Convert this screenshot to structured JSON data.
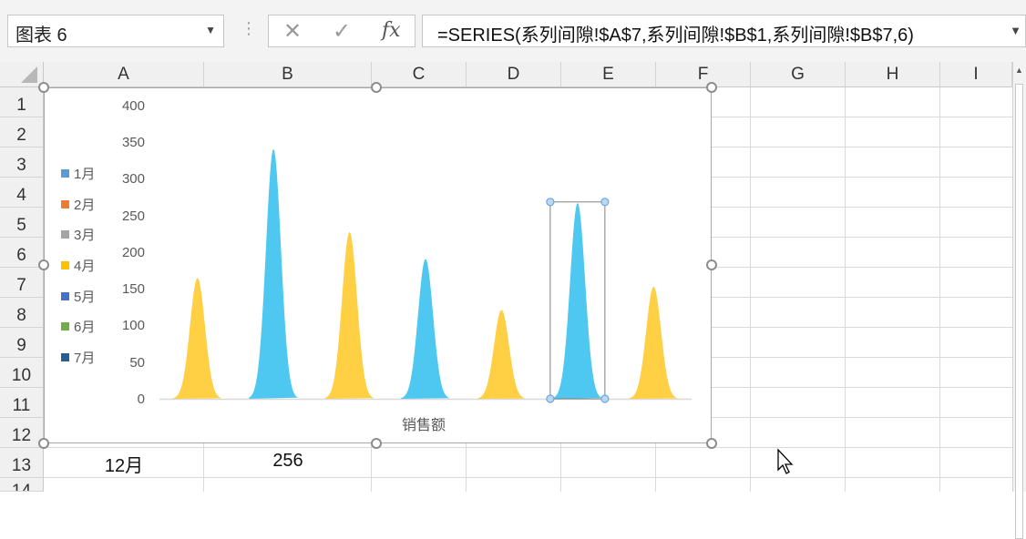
{
  "namebox": {
    "value": "图表 6"
  },
  "formula_bar": {
    "formula": "=SERIES(系列间隙!$A$7,系列间隙!$B$1,系列间隙!$B$7,6)"
  },
  "columns": [
    "A",
    "B",
    "C",
    "D",
    "E",
    "F",
    "G",
    "H",
    "I"
  ],
  "rows": [
    "1",
    "2",
    "3",
    "4",
    "5",
    "6",
    "7",
    "8",
    "9",
    "10",
    "11",
    "12",
    "13",
    "14"
  ],
  "cells": {
    "A13": "12月",
    "B13": "256"
  },
  "icons": {
    "cancel": "close-icon",
    "confirm": "check-icon",
    "function": "fx-icon"
  },
  "colors": {
    "yellow": "#FFCF44",
    "blue": "#4EC8F0",
    "selection": "#6AA6E0"
  },
  "chart_data": {
    "type": "area",
    "title": "",
    "xlabel": "销售额",
    "ylabel": "",
    "ylim": [
      0,
      400
    ],
    "yticks": [
      "0",
      "50",
      "100",
      "150",
      "200",
      "250",
      "300",
      "350",
      "400"
    ],
    "legend_position": "left",
    "legend": [
      {
        "label": "1月",
        "color": "#5B9BD5"
      },
      {
        "label": "2月",
        "color": "#ED7D31"
      },
      {
        "label": "3月",
        "color": "#A5A5A5"
      },
      {
        "label": "4月",
        "color": "#FFC000"
      },
      {
        "label": "5月",
        "color": "#4472C4"
      },
      {
        "label": "6月",
        "color": "#70AD47"
      },
      {
        "label": "7月",
        "color": "#255E91"
      }
    ],
    "peaks": [
      {
        "value": 166,
        "color": "yellow"
      },
      {
        "value": 343,
        "color": "blue"
      },
      {
        "value": 229,
        "color": "yellow"
      },
      {
        "value": 192,
        "color": "blue"
      },
      {
        "value": 122,
        "color": "yellow"
      },
      {
        "value": 269,
        "color": "blue",
        "selected": true
      },
      {
        "value": 154,
        "color": "yellow"
      }
    ]
  }
}
